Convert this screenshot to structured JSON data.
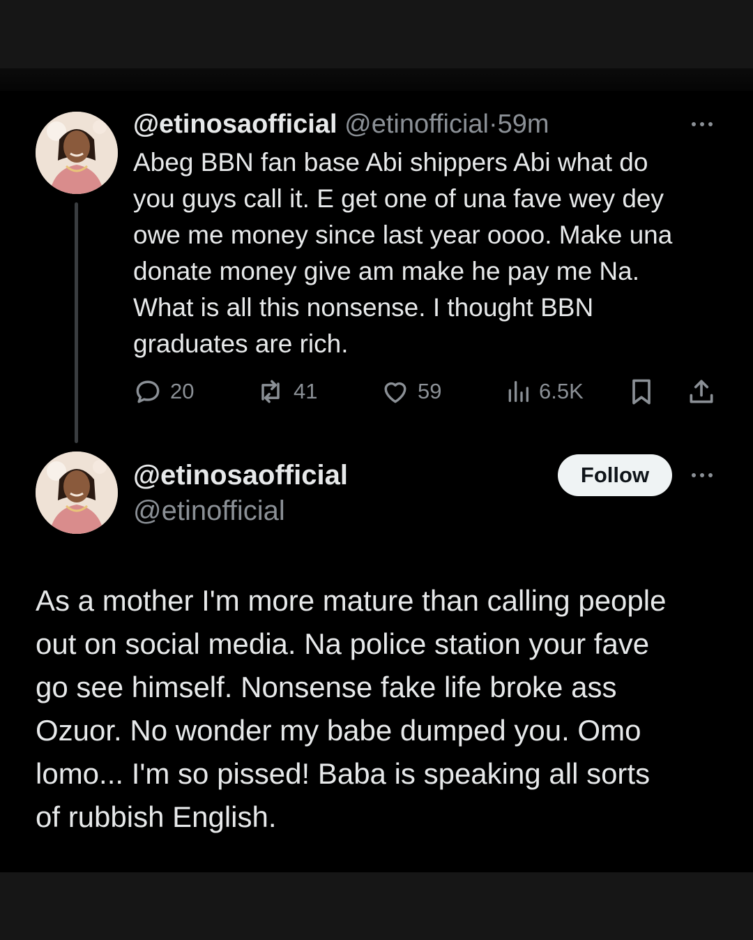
{
  "reply_tweet": {
    "display_name": "@etinosaofficial",
    "handle": "@etinofficial",
    "separator": "·",
    "time": "59m",
    "text": "Abeg BBN fan base Abi shippers Abi what do\nyou guys call it. E get one of una fave wey dey\nowe me money since last year oooo. Make una\ndonate money give am make he pay me Na.\nWhat is all this nonsense. I thought BBN\ngraduates are rich.",
    "replies": "20",
    "reposts": "41",
    "likes": "59",
    "views": "6.5K"
  },
  "main_tweet": {
    "display_name": "@etinosaofficial",
    "handle": "@etinofficial",
    "follow_label": "Follow",
    "text": "As a mother I'm more mature than calling people\nout on social media. Na police station your fave\ngo see himself. Nonsense fake life broke ass\nOzuor. No wonder my babe dumped you. Omo\nlomo... I'm so pissed! Baba is speaking all sorts\nof rubbish English."
  },
  "icons": {
    "reply": "speech-bubble-icon",
    "repost": "repost-arrows-icon",
    "like": "heart-icon",
    "views": "bar-chart-icon",
    "bookmark": "bookmark-icon",
    "share": "share-upload-icon",
    "more": "more-dots-icon"
  },
  "colors": {
    "background": "#000000",
    "text": "#e7e9ea",
    "secondary_text": "#8b9096",
    "follow_button_bg": "#eff3f4",
    "follow_button_text": "#0f1419",
    "thread_line": "#3a3d40"
  }
}
